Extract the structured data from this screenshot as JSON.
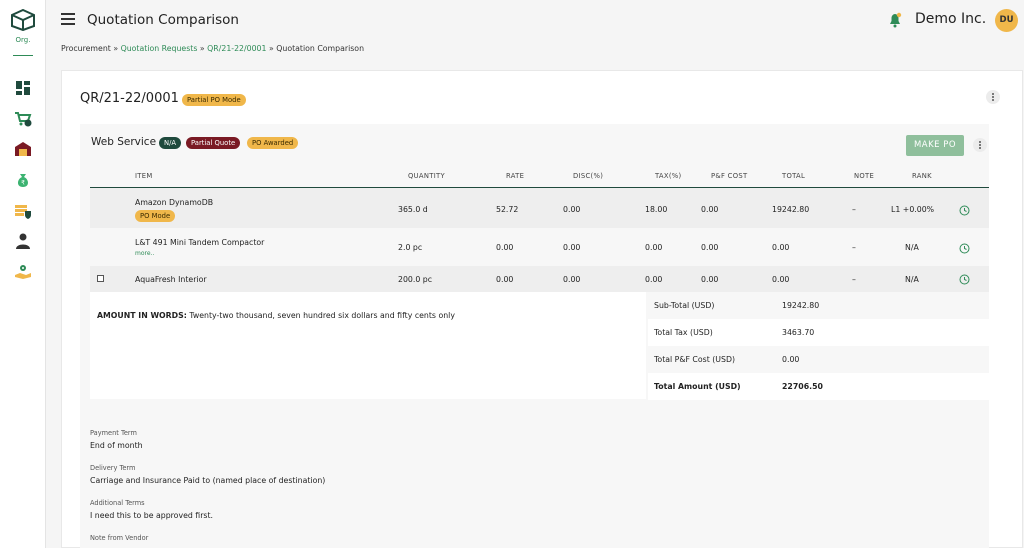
{
  "sidebar": {
    "org_label": "Org.",
    "icons": [
      "dashboard-icon",
      "cart-icon",
      "warehouse-icon",
      "money-bag-icon",
      "shield-card-icon",
      "user-icon",
      "settings-hand-icon"
    ]
  },
  "header": {
    "title": "Quotation Comparison",
    "company": "Demo Inc.",
    "avatar": "DU"
  },
  "breadcrumb": {
    "root": "Procurement",
    "sep": "»",
    "link1": "Quotation Requests",
    "link2": "QR/21-22/0001",
    "current": "Quotation Comparison"
  },
  "quotation": {
    "id": "QR/21-22/0001",
    "mode_badge": "Partial PO Mode"
  },
  "vendor": {
    "name": "Web Service",
    "badges": [
      "N/A",
      "Partial Quote",
      "PO Awarded"
    ],
    "make_po_label": "MAKE PO"
  },
  "table": {
    "columns": [
      "ITEM",
      "QUANTITY",
      "RATE",
      "DISC(%)",
      "TAX(%)",
      "P&F COST",
      "TOTAL",
      "NOTE",
      "RANK"
    ],
    "rows": [
      {
        "item": "Amazon DynamoDB",
        "tag": "PO Mode",
        "quantity": "365.0 d",
        "rate": "52.72",
        "disc": "0.00",
        "tax": "18.00",
        "pf": "0.00",
        "total": "19242.80",
        "note": "–",
        "rank": "L1 +0.00%"
      },
      {
        "item": "L&T 491 Mini Tandem Compactor",
        "more": "more..",
        "quantity": "2.0 pc",
        "rate": "0.00",
        "disc": "0.00",
        "tax": "0.00",
        "pf": "0.00",
        "total": "0.00",
        "note": "–",
        "rank": "N/A"
      },
      {
        "item": "AquaFresh Interior",
        "quantity": "200.0 pc",
        "rate": "0.00",
        "disc": "0.00",
        "tax": "0.00",
        "pf": "0.00",
        "total": "0.00",
        "note": "–",
        "rank": "N/A"
      }
    ]
  },
  "amount_words": {
    "label": "AMOUNT IN WORDS:",
    "value": "Twenty-two thousand, seven hundred six dollars and fifty cents only"
  },
  "totals": [
    {
      "label": "Sub-Total (USD)",
      "value": "19242.80"
    },
    {
      "label": "Total Tax (USD)",
      "value": "3463.70"
    },
    {
      "label": "Total P&F Cost (USD)",
      "value": "0.00"
    },
    {
      "label": "Total Amount (USD)",
      "value": "22706.50"
    }
  ],
  "terms": [
    {
      "label": "Payment Term",
      "value": "End of month"
    },
    {
      "label": "Delivery Term",
      "value": "Carriage and Insurance Paid to (named place of destination)"
    },
    {
      "label": "Additional Terms",
      "value": "I need this to be approved first."
    },
    {
      "label": "Note from Vendor",
      "value": ""
    }
  ],
  "colors": {
    "accent_green": "#2e8b57",
    "dark_green": "#1f4a3d",
    "orange": "#f0b74a",
    "maroon": "#7a1a24"
  }
}
